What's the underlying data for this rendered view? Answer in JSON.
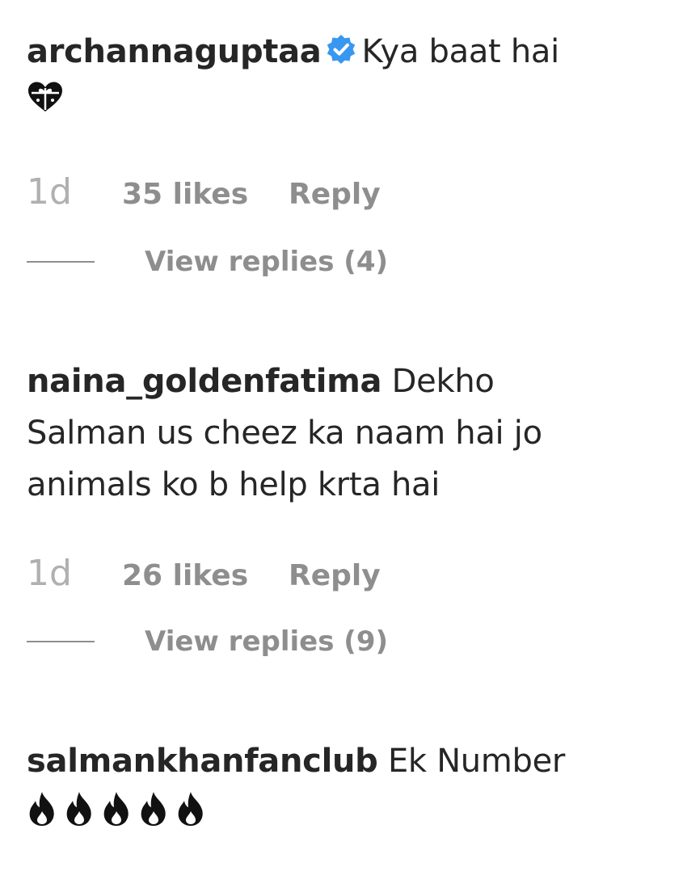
{
  "comments": [
    {
      "username": "archannaguptaa",
      "verified": true,
      "text": "Kya baat hai",
      "emoji_line": "💝",
      "time": "1d",
      "likes": "35 likes",
      "reply_label": "Reply",
      "view_replies": "View replies (4)"
    },
    {
      "username": "naina_goldenfatima",
      "verified": false,
      "text": "Dekho",
      "text_line2": "Salman us cheez ka naam hai jo",
      "text_line3": "animals ko b help krta hai",
      "time": "1d",
      "likes": "26 likes",
      "reply_label": "Reply",
      "view_replies": "View replies (9)"
    },
    {
      "username": "salmankhanfanclub",
      "verified": false,
      "text": "Ek Number",
      "emoji_line": "🔥🔥🔥🔥🔥",
      "emoji_icon": "fire-icon",
      "emoji_count": 5
    }
  ],
  "colors": {
    "text": "#262626",
    "secondary": "#8e8e8e",
    "verified_blue": "#3897f0"
  }
}
